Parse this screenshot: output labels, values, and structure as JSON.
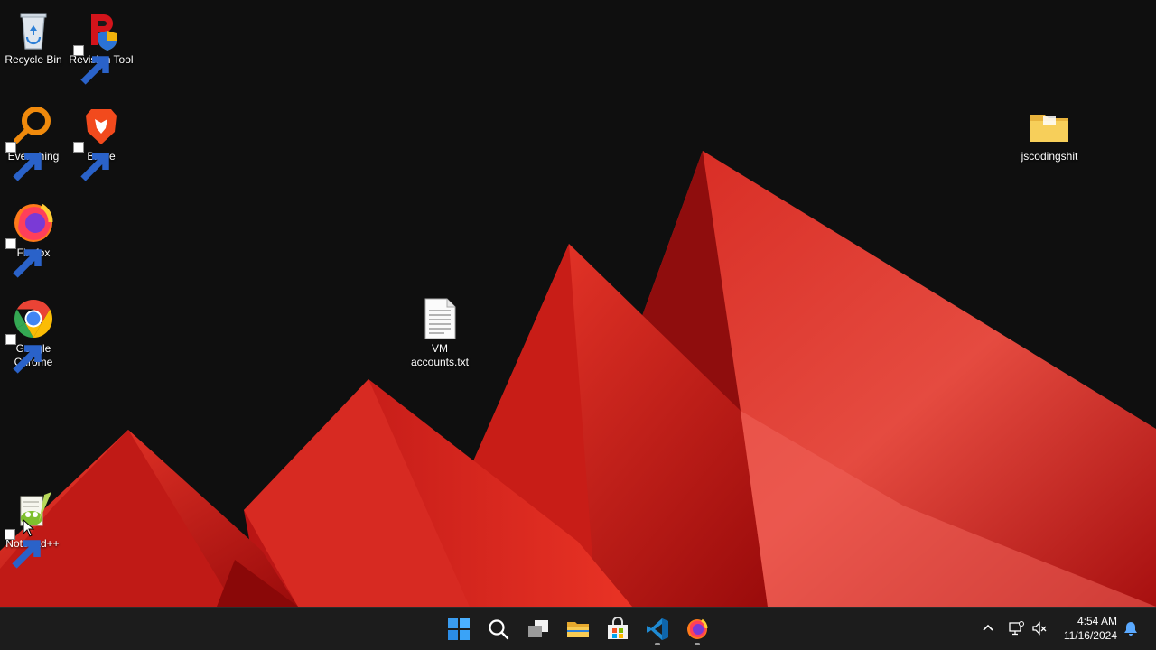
{
  "desktop": {
    "icons": [
      {
        "name": "recycle-bin",
        "label": "Recycle Bin",
        "icon": "recycle-bin-icon"
      },
      {
        "name": "revision-tool",
        "label": "Revision Tool",
        "icon": "revision-tool-icon"
      },
      {
        "name": "everything",
        "label": "Everything",
        "icon": "magnifier-ring-icon"
      },
      {
        "name": "brave",
        "label": "Brave",
        "icon": "brave-lion-icon"
      },
      {
        "name": "firefox",
        "label": "Firefox",
        "icon": "firefox-icon"
      },
      {
        "name": "google-chrome",
        "label": "Google Chrome",
        "icon": "chrome-icon"
      },
      {
        "name": "notepad-plus-plus",
        "label": "Notepad++",
        "icon": "notepad-plus-plus-icon"
      },
      {
        "name": "vm-accounts-txt",
        "label": "VM accounts.txt",
        "icon": "text-file-icon"
      },
      {
        "name": "jscodingshit-folder",
        "label": "jscodingshit",
        "icon": "folder-icon"
      }
    ]
  },
  "taskbar": {
    "items": [
      {
        "name": "start",
        "icon": "windows-start-icon"
      },
      {
        "name": "search",
        "icon": "search-icon"
      },
      {
        "name": "task-view",
        "icon": "task-view-icon"
      },
      {
        "name": "file-explorer",
        "icon": "folder-icon"
      },
      {
        "name": "microsoft-store",
        "icon": "store-icon"
      },
      {
        "name": "vscode",
        "icon": "vscode-icon",
        "running": true
      },
      {
        "name": "firefox",
        "icon": "firefox-icon",
        "running": true
      }
    ],
    "tray": {
      "time": "4:54 AM",
      "date": "11/16/2024"
    }
  },
  "colors": {
    "background": "#0f0f0f",
    "wallpaper_red": "#e8251f",
    "taskbar": "#1c1c1c",
    "folder_yellow": "#f7cf5a"
  }
}
